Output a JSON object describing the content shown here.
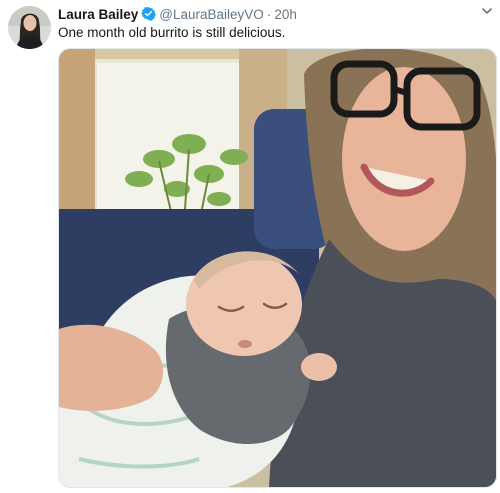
{
  "tweet": {
    "display_name": "Laura Bailey",
    "handle": "@LauraBaileyVO",
    "separator": "·",
    "time": "20h",
    "text": "One month old burrito is still delicious.",
    "verified": true,
    "avatar_icon": "profile-photo",
    "verified_icon": "verified-badge-icon",
    "menu_icon": "chevron-down-icon"
  },
  "media": {
    "kind": "photo",
    "subject": "photo"
  },
  "colors": {
    "accent": "#1da1f2",
    "secondary_text": "#657786",
    "primary_text": "#14171a"
  }
}
